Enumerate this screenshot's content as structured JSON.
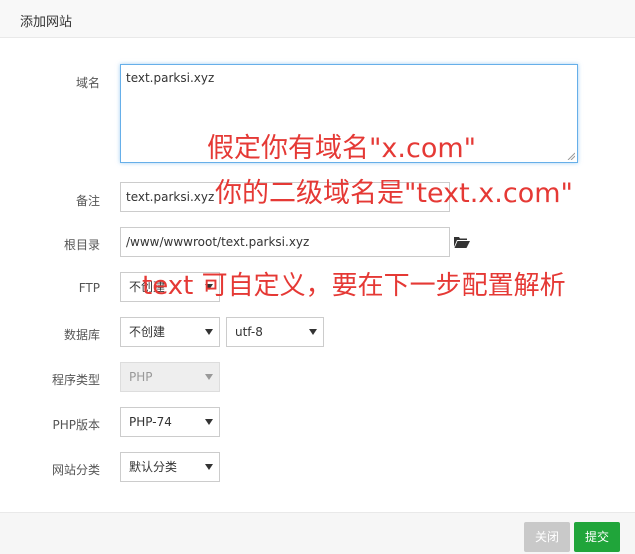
{
  "dialog": {
    "title": "添加网站"
  },
  "form": {
    "domain": {
      "label": "域名",
      "value": "text.parksi.xyz"
    },
    "remark": {
      "label": "备注",
      "value": "text.parksi.xyz"
    },
    "root": {
      "label": "根目录",
      "value": "/www/wwwroot/text.parksi.xyz"
    },
    "ftp": {
      "label": "FTP",
      "value": "不创建"
    },
    "database": {
      "label": "数据库",
      "value": "不创建",
      "charset": "utf-8"
    },
    "program_type": {
      "label": "程序类型",
      "value": "PHP"
    },
    "php_version": {
      "label": "PHP版本",
      "value": "PHP-74"
    },
    "category": {
      "label": "网站分类",
      "value": "默认分类"
    }
  },
  "annotations": {
    "line1": "假定你有域名\"x.com\"",
    "line2": "你的二级域名是\"text.x.com\"",
    "line3": "text 可自定义，要在下一步配置解析"
  },
  "footer": {
    "close_label": "关闭",
    "submit_label": "提交"
  },
  "colors": {
    "accent": "#20a53a",
    "annotation": "#e53935",
    "focus": "#66afe9"
  }
}
